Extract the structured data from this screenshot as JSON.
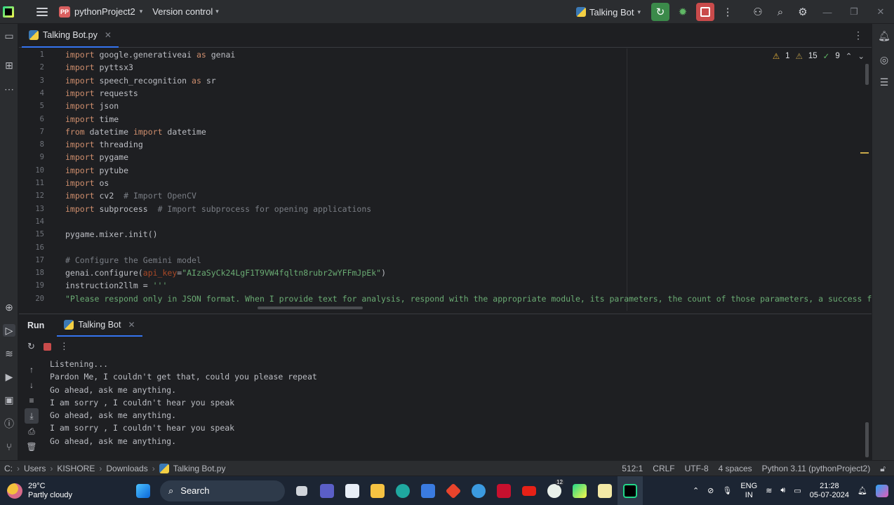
{
  "titlebar": {
    "project_badge": "PP",
    "project_name": "pythonProject2",
    "vcs_label": "Version control",
    "run_config": "Talking Bot"
  },
  "editor_tab": {
    "label": "Talking Bot.py"
  },
  "inspections": {
    "warnings": "1",
    "weak_warnings": "15",
    "ok": "9"
  },
  "code_lines": [
    {
      "n": "1"
    },
    {
      "n": "2"
    },
    {
      "n": "3"
    },
    {
      "n": "4"
    },
    {
      "n": "5"
    },
    {
      "n": "6"
    },
    {
      "n": "7"
    },
    {
      "n": "8"
    },
    {
      "n": "9"
    },
    {
      "n": "10"
    },
    {
      "n": "11"
    },
    {
      "n": "12"
    },
    {
      "n": "13"
    },
    {
      "n": "14"
    },
    {
      "n": "15"
    },
    {
      "n": "16"
    },
    {
      "n": "17"
    },
    {
      "n": "18"
    },
    {
      "n": "19"
    },
    {
      "n": "20"
    }
  ],
  "code": {
    "l1": [
      "import",
      " google.generativeai ",
      "as",
      " genai"
    ],
    "l2": [
      "import",
      " pyttsx3"
    ],
    "l3": [
      "import",
      " speech_recognition ",
      "as",
      " sr"
    ],
    "l4": [
      "import",
      " requests"
    ],
    "l5": [
      "import",
      " json"
    ],
    "l6": [
      "import",
      " time"
    ],
    "l7": [
      "from",
      " datetime ",
      "import",
      " datetime"
    ],
    "l8": [
      "import",
      " threading"
    ],
    "l9": [
      "import",
      " pygame"
    ],
    "l10": [
      "import",
      " pytube"
    ],
    "l11": [
      "import",
      " os"
    ],
    "l12": [
      "import",
      " cv2  ",
      "# Import OpenCV"
    ],
    "l13": [
      "import",
      " subprocess  ",
      "# Import subprocess for opening applications"
    ],
    "l15": "pygame.mixer.init()",
    "l17": "# Configure the Gemini model",
    "l18": [
      "genai.configure(",
      "api_key",
      "=",
      "\"AIzaSyCk24LgF1T9VW4fqltn8rubr2wYFFmJpEk\"",
      ")"
    ],
    "l19": [
      "instruction2llm = ",
      "'''"
    ],
    "l20": "\"Please respond only in JSON format. When I provide text for analysis, respond with the appropriate module, its parameters, the count of those parameters, a success flag, a"
  },
  "run_panel": {
    "title": "Run",
    "tab_label": "Talking Bot",
    "console": [
      "Listening...",
      "Pardon Me, I couldn't get that, could you please repeat",
      "Go ahead, ask me anything.",
      "I am sorry , I couldn't hear you speak",
      "Go ahead, ask me anything.",
      "I am sorry , I couldn't hear you speak",
      "Go ahead, ask me anything."
    ]
  },
  "statusbar": {
    "crumbs": [
      "C:",
      "Users",
      "KISHORE",
      "Downloads",
      "Talking Bot.py"
    ],
    "position": "512:1",
    "line_sep": "CRLF",
    "encoding": "UTF-8",
    "indent": "4 spaces",
    "interpreter": "Python 3.11 (pythonProject2)"
  },
  "taskbar": {
    "temp": "29°C",
    "weather": "Partly cloudy",
    "search": "Search",
    "lang1": "ENG",
    "lang2": "IN",
    "time": "21:28",
    "date": "05-07-2024",
    "badge": "12"
  },
  "colors": {
    "accent": "#3574f0",
    "run_green": "#3b8a4a",
    "stop_red": "#c94b4b",
    "keyword": "#cf8e6d",
    "string": "#6aab73",
    "comment": "#7a7e85"
  }
}
